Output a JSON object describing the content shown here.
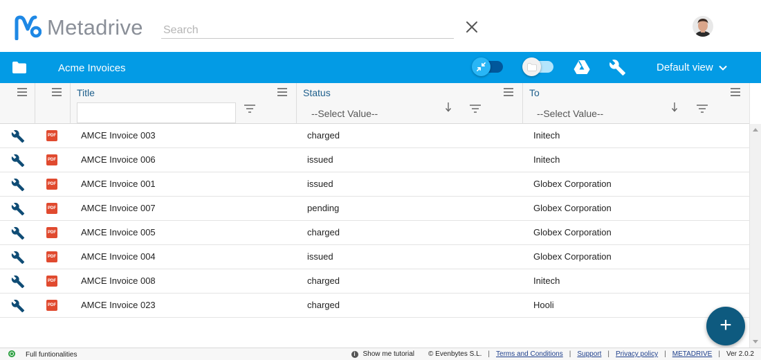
{
  "header": {
    "app_name": "Metadrive",
    "search_placeholder": "Search"
  },
  "toolbar": {
    "title": "Acme Invoices",
    "view_label": "Default view"
  },
  "grid": {
    "columns": {
      "title": "Title",
      "status": "Status",
      "to": "To"
    },
    "select_placeholder": "--Select Value--",
    "rows": [
      {
        "title": "AMCE Invoice 003",
        "status": "charged",
        "to": "Initech"
      },
      {
        "title": "AMCE Invoice 006",
        "status": "issued",
        "to": "Initech"
      },
      {
        "title": "AMCE Invoice 001",
        "status": "issued",
        "to": "Globex Corporation"
      },
      {
        "title": "AMCE Invoice 007",
        "status": "pending",
        "to": "Globex Corporation"
      },
      {
        "title": "AMCE Invoice 005",
        "status": "charged",
        "to": "Globex Corporation"
      },
      {
        "title": "AMCE Invoice 004",
        "status": "issued",
        "to": "Globex Corporation"
      },
      {
        "title": "AMCE Invoice 008",
        "status": "charged",
        "to": "Initech"
      },
      {
        "title": "AMCE Invoice 023",
        "status": "charged",
        "to": "Hooli"
      }
    ],
    "pdf_label": "PDF"
  },
  "fab_label": "+",
  "footer": {
    "mode": "Full funtionalities",
    "tutorial": "Show me tutorial",
    "copyright": "© Evenbytes S.L.",
    "terms": "Terms and Conditions",
    "support": "Support",
    "privacy": "Privacy policy",
    "metadrive": "METADRIVE",
    "version": "Ver 2.0.2",
    "separator": "|"
  },
  "colors": {
    "toolbar": "#039be5",
    "fab": "#0e5a7f",
    "logo_blue": "#1e88e5",
    "pdf_red": "#e04a2f"
  }
}
